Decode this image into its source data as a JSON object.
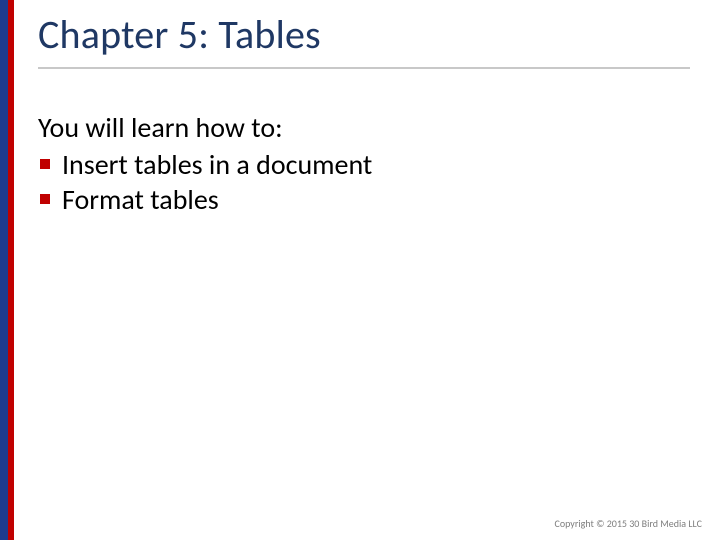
{
  "slide": {
    "title": "Chapter 5: Tables",
    "intro": "You will learn how to:",
    "bullets": [
      "Insert tables in a document",
      "Format tables"
    ],
    "copyright": "Copyright © 2015 30 Bird Media LLC"
  },
  "colors": {
    "stripe_blue": "#1f3b8f",
    "stripe_red": "#c00000",
    "title_color": "#1f3864",
    "rule_color": "#c8c8c8",
    "bullet_marker": "#c00000"
  }
}
